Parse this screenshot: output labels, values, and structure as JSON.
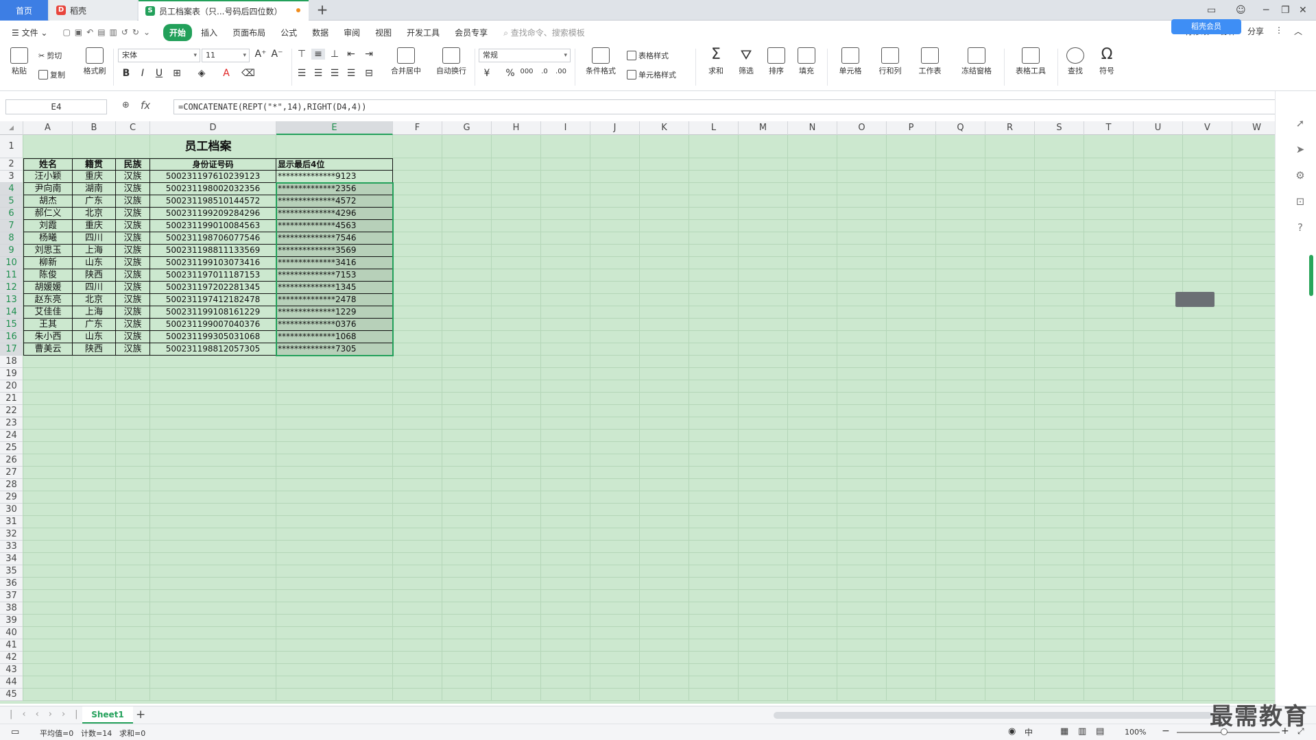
{
  "tabs": {
    "home": "首页",
    "daoke": "稻壳",
    "file": "员工档案表（只...号码后四位数）",
    "add": "+"
  },
  "menu": {
    "file": "文件",
    "items": [
      "开始",
      "插入",
      "页面布局",
      "公式",
      "数据",
      "审阅",
      "视图",
      "开发工具",
      "会员专享"
    ],
    "search": "查找命令、搜索模板",
    "right": [
      "有修改",
      "协作",
      "分享"
    ],
    "cloud_badge": "稻壳会员"
  },
  "ribbon": {
    "paste": "粘贴",
    "cut": "剪切",
    "copy": "复制",
    "format_painter": "格式刷",
    "font_name": "宋体",
    "font_size": "11",
    "bold": "B",
    "italic": "I",
    "underline": "U",
    "merge": "合并居中",
    "wrap": "自动换行",
    "number_format": "常规",
    "currency": "¥",
    "percent": "%",
    "thousands": "000",
    "cond_format": "条件格式",
    "table_style": "表格样式",
    "cell_style": "单元格样式",
    "sum": "求和",
    "filter": "筛选",
    "sort": "排序",
    "fill": "填充",
    "cell": "单元格",
    "rowcol": "行和列",
    "sheet": "工作表",
    "freeze": "冻结窗格",
    "table_tools": "表格工具",
    "find": "查找",
    "symbol": "符号"
  },
  "formula_bar": {
    "name_box": "E4",
    "fx": "fx",
    "formula": "=CONCATENATE(REPT(\"*\",14),RIGHT(D4,4))"
  },
  "columns": [
    "A",
    "B",
    "C",
    "D",
    "E",
    "F",
    "G",
    "H",
    "I",
    "J",
    "K",
    "L",
    "M",
    "N",
    "O",
    "P",
    "Q",
    "R",
    "S",
    "T",
    "U",
    "V",
    "W"
  ],
  "selected_column": "E",
  "rows_visible": 45,
  "sheet": {
    "title": "员工档案",
    "headers": [
      "姓名",
      "籍贯",
      "民族",
      "身份证号码",
      "显示最后4位"
    ],
    "rows": [
      [
        "汪小颖",
        "重庆",
        "汉族",
        "500231197610239123",
        "**************9123"
      ],
      [
        "尹向南",
        "湖南",
        "汉族",
        "500231198002032356",
        "**************2356"
      ],
      [
        "胡杰",
        "广东",
        "汉族",
        "500231198510144572",
        "**************4572"
      ],
      [
        "郝仁义",
        "北京",
        "汉族",
        "500231199209284296",
        "**************4296"
      ],
      [
        "刘霞",
        "重庆",
        "汉族",
        "500231199010084563",
        "**************4563"
      ],
      [
        "杨曦",
        "四川",
        "汉族",
        "500231198706077546",
        "**************7546"
      ],
      [
        "刘思玉",
        "上海",
        "汉族",
        "500231198811133569",
        "**************3569"
      ],
      [
        "柳新",
        "山东",
        "汉族",
        "500231199103073416",
        "**************3416"
      ],
      [
        "陈俊",
        "陕西",
        "汉族",
        "500231197011187153",
        "**************7153"
      ],
      [
        "胡媛媛",
        "四川",
        "汉族",
        "500231197202281345",
        "**************1345"
      ],
      [
        "赵东亮",
        "北京",
        "汉族",
        "500231197412182478",
        "**************2478"
      ],
      [
        "艾佳佳",
        "上海",
        "汉族",
        "500231199108161229",
        "**************1229"
      ],
      [
        "王其",
        "广东",
        "汉族",
        "500231199007040376",
        "**************0376"
      ],
      [
        "朱小西",
        "山东",
        "汉族",
        "500231199305031068",
        "**************1068"
      ],
      [
        "曹美云",
        "陕西",
        "汉族",
        "500231198812057305",
        "**************7305"
      ]
    ]
  },
  "sheet_tab": "Sheet1",
  "status": {
    "avg": "平均值=0",
    "count": "计数=14",
    "sum": "求和=0",
    "zoom": "100%"
  },
  "watermark": "最需教育",
  "colors": {
    "accent": "#22a05a",
    "grid_bg": "#cce8cf",
    "home_tab": "#3d7ee4"
  }
}
